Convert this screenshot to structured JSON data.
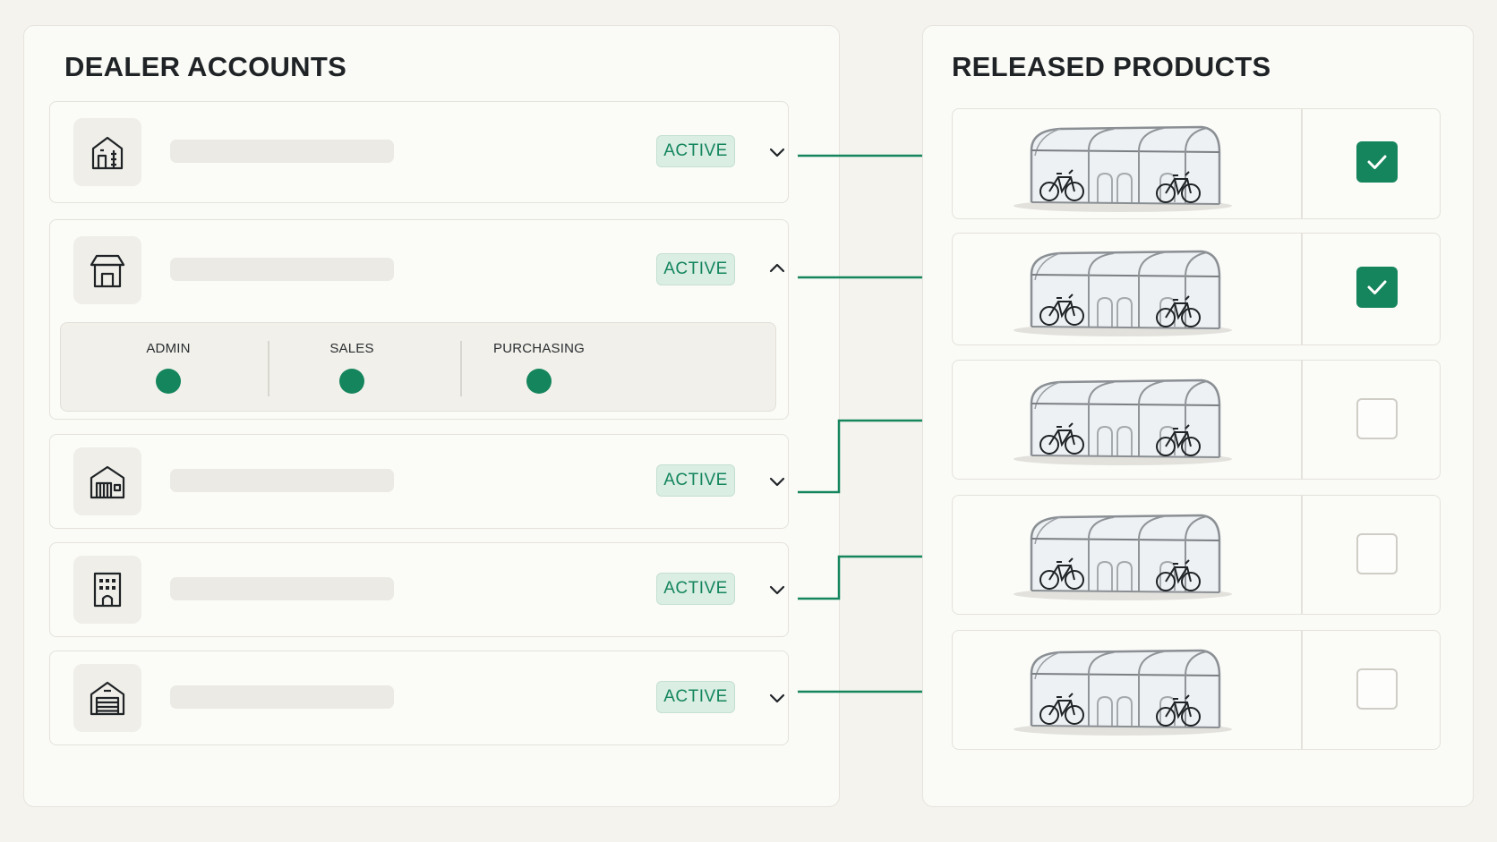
{
  "accounts_panel": {
    "title": "DEALER ACCOUNTS",
    "dealers": [
      {
        "icon": "office-building-icon",
        "status": "ACTIVE",
        "expanded": false
      },
      {
        "icon": "storefront-icon",
        "status": "ACTIVE",
        "expanded": true,
        "roles": [
          {
            "label": "ADMIN",
            "enabled": true
          },
          {
            "label": "SALES",
            "enabled": true
          },
          {
            "label": "PURCHASING",
            "enabled": true
          }
        ]
      },
      {
        "icon": "warehouse-icon",
        "status": "ACTIVE",
        "expanded": false
      },
      {
        "icon": "apartment-building-icon",
        "status": "ACTIVE",
        "expanded": false
      },
      {
        "icon": "garage-icon",
        "status": "ACTIVE",
        "expanded": false
      }
    ]
  },
  "products_panel": {
    "title": "RELEASED PRODUCTS",
    "products": [
      {
        "image": "bike-shelter-image",
        "released": true
      },
      {
        "image": "bike-shelter-image",
        "released": true
      },
      {
        "image": "bike-shelter-image",
        "released": false
      },
      {
        "image": "bike-shelter-image",
        "released": false
      },
      {
        "image": "bike-shelter-image",
        "released": false
      }
    ]
  },
  "colors": {
    "accent_green": "#15855d",
    "badge_bg": "#dbeee4",
    "background": "#f4f3ee",
    "panel_bg": "#fafaf6"
  }
}
